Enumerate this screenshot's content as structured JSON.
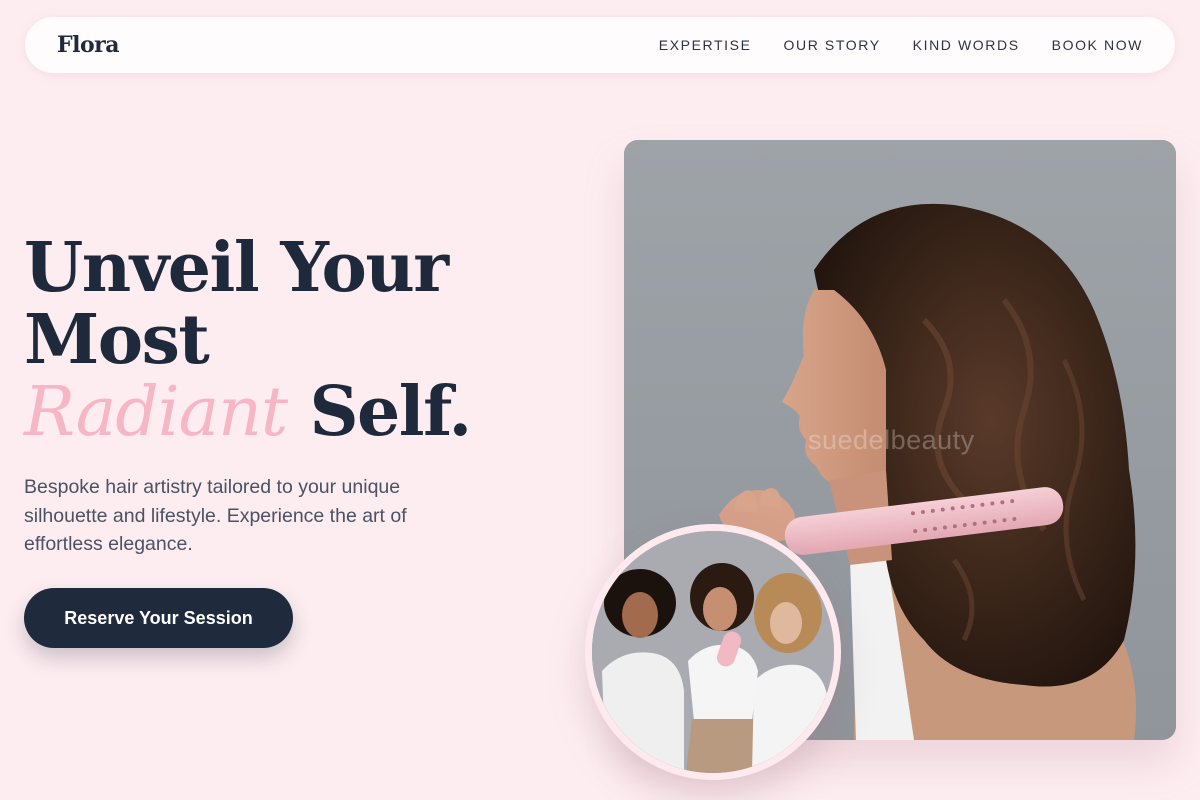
{
  "brand": {
    "logo": "Flora"
  },
  "nav": {
    "links": [
      {
        "label": "EXPERTISE"
      },
      {
        "label": "OUR STORY"
      },
      {
        "label": "KIND WORDS"
      },
      {
        "label": "BOOK NOW"
      }
    ]
  },
  "hero": {
    "title_line1": "Unveil Your",
    "title_line2": "Most",
    "title_accent": "Radiant",
    "title_end": "Self.",
    "subtitle": "Bespoke hair artistry tailored to your unique silhouette and lifestyle. Experience the art of effortless elegance.",
    "cta_label": "Reserve Your Session"
  },
  "media": {
    "main_image_watermark": "suedelbeauty",
    "main_image_alt": "woman-curling-hair-photo",
    "secondary_image_alt": "group-of-three-women-photo"
  },
  "colors": {
    "background": "#fdedf1",
    "accent_pink": "#f7b6c6",
    "navy": "#1f2a3d"
  }
}
